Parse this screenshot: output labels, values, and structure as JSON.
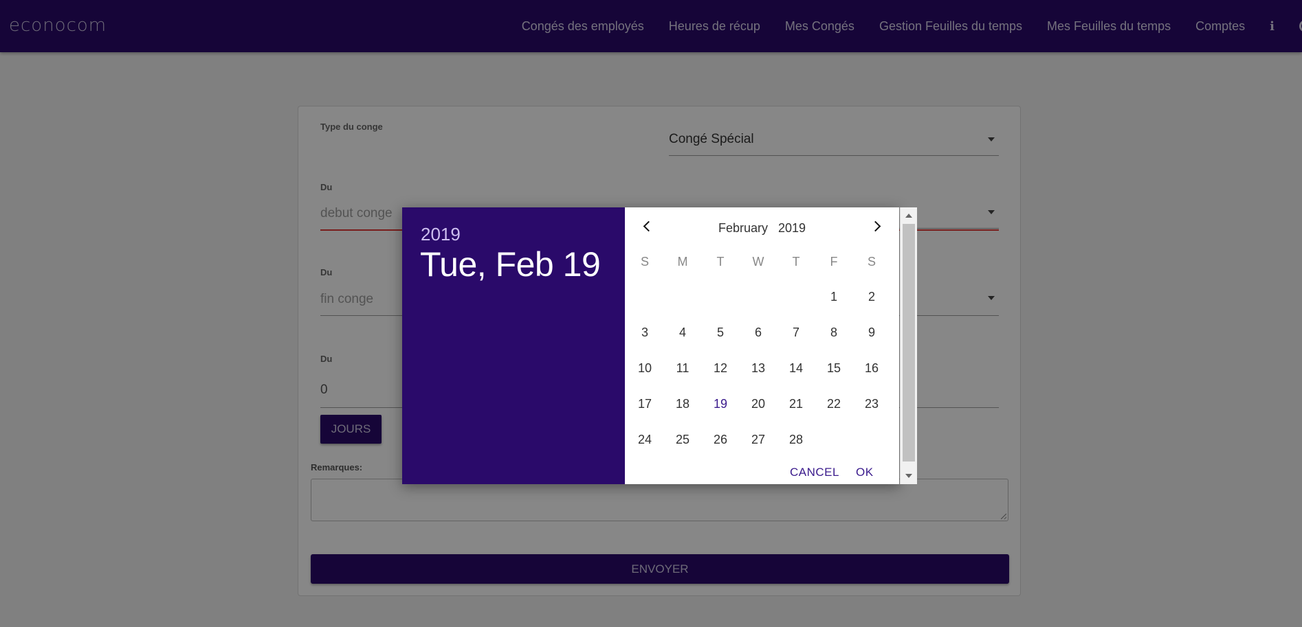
{
  "navbar": {
    "brand": "econocom",
    "links": [
      "Congés des employés",
      "Heures de récup",
      "Mes Congés",
      "Gestion Feuilles du temps",
      "Mes Feuilles du temps",
      "Comptes"
    ],
    "info_icon": "info-icon",
    "partial_icon": "power-icon"
  },
  "form": {
    "type_label": "Type du conge",
    "type_value": "Congé Spécial",
    "start_label": "Du",
    "start_placeholder": "debut conge",
    "end_label": "Du",
    "end_placeholder": "fin conge",
    "days_label": "Du",
    "days_value": "0",
    "jours_button": "JOURS",
    "remarks_label": "Remarques:",
    "submit_button": "ENVOYER"
  },
  "datepicker": {
    "header_year": "2019",
    "header_date": "Tue, Feb 19",
    "month": "February",
    "year": "2019",
    "weekdays": [
      "S",
      "M",
      "T",
      "W",
      "T",
      "F",
      "S"
    ],
    "first_weekday_index": 5,
    "days_in_month": 28,
    "selected_day": 19,
    "cancel_button": "CANCEL",
    "ok_button": "OK"
  },
  "colors": {
    "primary": "#2a0a6a",
    "selected_day": "#3a1a8c",
    "error": "#e53935"
  }
}
